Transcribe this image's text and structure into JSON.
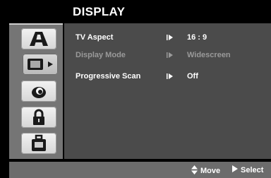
{
  "menu": {
    "title": "DISPLAY"
  },
  "sidebar": {
    "tabs": [
      {
        "icon": "language-a-icon"
      },
      {
        "icon": "display-monitor-icon",
        "active": true
      },
      {
        "icon": "audio-icon"
      },
      {
        "icon": "lock-icon"
      },
      {
        "icon": "others-bag-icon"
      }
    ]
  },
  "settings": [
    {
      "label": "TV Aspect",
      "value": "16 : 9",
      "enabled": true
    },
    {
      "label": "Display Mode",
      "value": "Widescreen",
      "enabled": false
    },
    {
      "label": "Progressive Scan",
      "value": "Off",
      "enabled": true
    }
  ],
  "footer": {
    "move_label": "Move",
    "select_label": "Select"
  }
}
